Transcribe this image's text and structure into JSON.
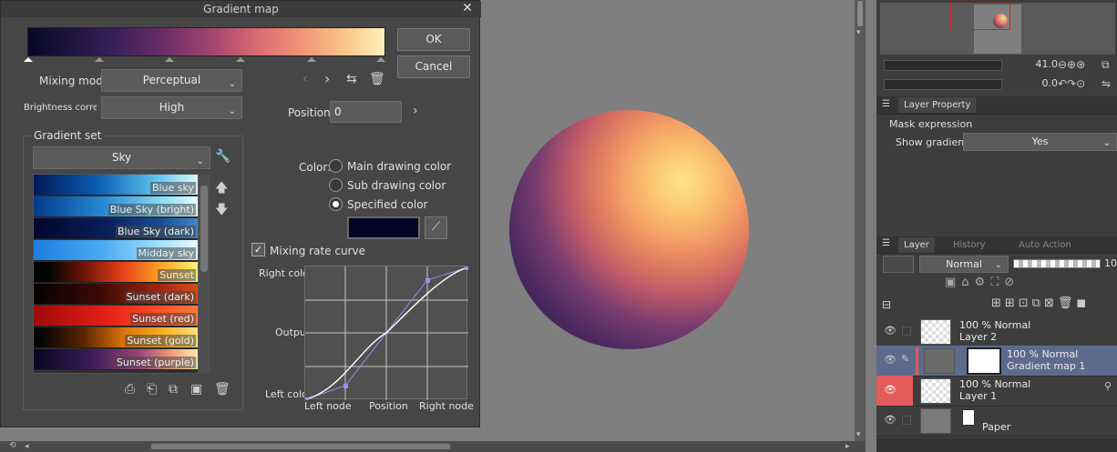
{
  "dialog": {
    "title": "Gradient map",
    "ok_label": "OK",
    "cancel_label": "Cancel",
    "mixing_mode_label": "Mixing mode:",
    "mixing_mode_value": "Perceptual",
    "brightness_label": "Brightness correction",
    "brightness_value": "High",
    "position_label": "Position:",
    "position_value": "0",
    "gradient_set_label": "Gradient set",
    "gradient_set_value": "Sky",
    "swatches": [
      {
        "name": "Blue sky"
      },
      {
        "name": "Blue Sky (bright)"
      },
      {
        "name": "Blue Sky (dark)"
      },
      {
        "name": "Midday sky"
      },
      {
        "name": "Sunset"
      },
      {
        "name": "Sunset (dark)"
      },
      {
        "name": "Sunset (red)"
      },
      {
        "name": "Sunset (gold)"
      },
      {
        "name": "Sunset (purple)"
      }
    ],
    "color_label": "Color:",
    "color_options": [
      "Main drawing color",
      "Sub drawing color",
      "Specified color"
    ],
    "color_selected": "Specified color",
    "specified_color": "#050626",
    "mixing_curve_label": "Mixing rate curve",
    "mixing_curve_checked": true,
    "graph": {
      "right_color": "Right color",
      "output": "Output",
      "left_color": "Left color",
      "left_node": "Left node",
      "position": "Position",
      "right_node": "Right node"
    }
  },
  "right_panel": {
    "zoom_value": "41.0",
    "rotate_value": "0.0",
    "layer_property_tab": "Layer Property",
    "mask_expression_label": "Mask expression",
    "show_gradients_label": "Show gradients",
    "show_gradients_value": "Yes",
    "layer_tabs": [
      "Layer",
      "History",
      "Auto Action"
    ],
    "blend_mode": "Normal",
    "opacity_cut": "10",
    "layers": [
      {
        "line1": "100 % Normal",
        "line2": "Layer 2"
      },
      {
        "line1": "100 % Normal",
        "line2": "Gradient map 1"
      },
      {
        "line1": "100 % Normal",
        "line2": "Layer 1"
      },
      {
        "line1": "",
        "line2": "Paper"
      }
    ]
  },
  "colors": {
    "accent": "#e35b5b",
    "selected_layer": "#5c6a8c"
  }
}
